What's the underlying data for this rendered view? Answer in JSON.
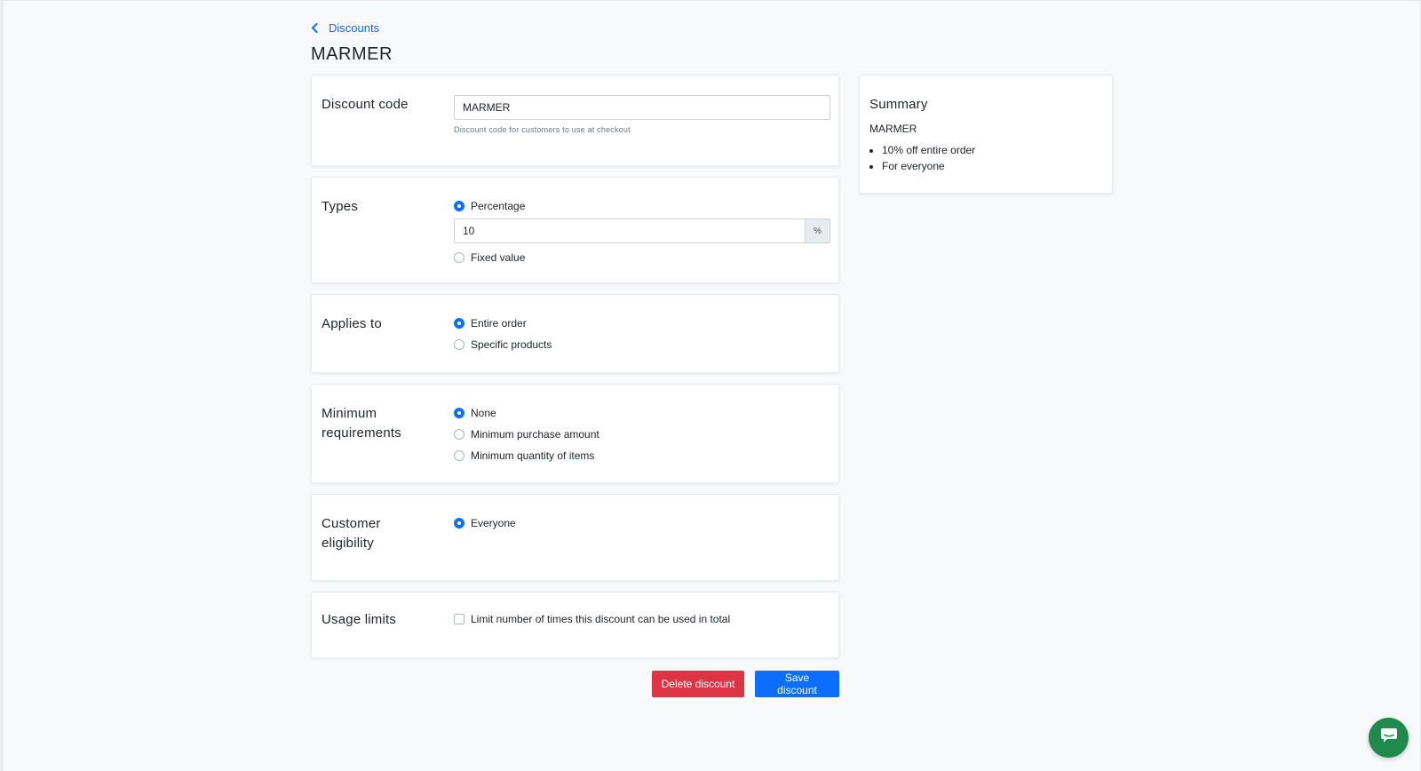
{
  "breadcrumb": {
    "back_label": "Discounts"
  },
  "page": {
    "title": "MARMER"
  },
  "discount_code": {
    "label": "Discount code",
    "value": "MARMER",
    "help": "Discount code for customers to use at checkout"
  },
  "types": {
    "label": "Types",
    "option_percentage": "Percentage",
    "percentage_value": "10",
    "percentage_suffix": "%",
    "option_fixed": "Fixed value",
    "selected": "Percentage"
  },
  "applies_to": {
    "label": "Applies to",
    "option_entire": "Entire order",
    "option_specific": "Specific products",
    "selected": "Entire order"
  },
  "minimum": {
    "label": "Minimum requirements",
    "option_none": "None",
    "option_amount": "Minimum purchase amount",
    "option_quantity": "Minimum quantity of items",
    "selected": "None"
  },
  "eligibility": {
    "label": "Customer eligibility",
    "option_everyone": "Everyone",
    "selected": "Everyone"
  },
  "usage": {
    "label": "Usage limits",
    "option_limit_total": "Limit number of times this discount can be used in total",
    "limit_total_checked": false
  },
  "summary": {
    "title": "Summary",
    "code": "MARMER",
    "items": [
      "10% off entire order",
      "For everyone"
    ]
  },
  "actions": {
    "delete_label": "Delete discount",
    "save_label": "Save discount"
  },
  "colors": {
    "primary": "#0d6efd",
    "danger": "#dc3545",
    "chat": "#1f8a4c"
  },
  "icons": {
    "back": "chevron-left-icon",
    "chat": "chat-icon"
  }
}
